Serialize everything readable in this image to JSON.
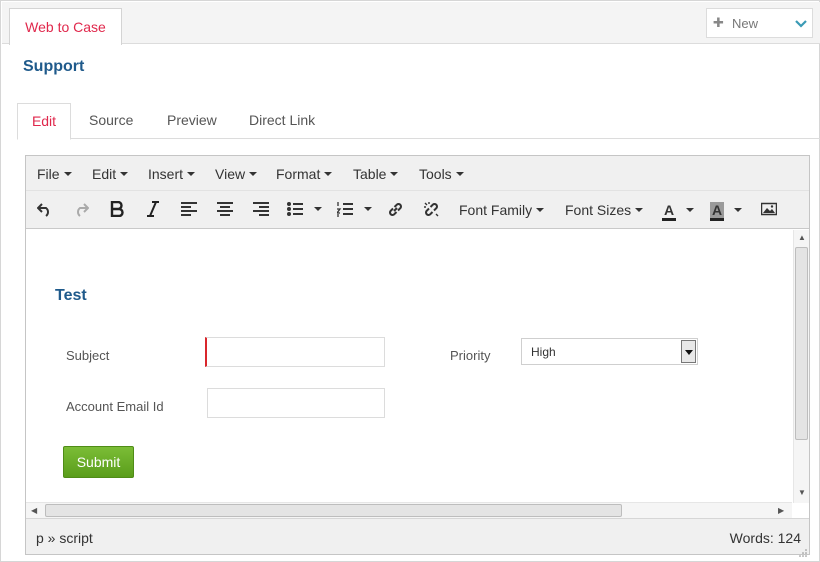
{
  "top_tab": {
    "label": "Web to Case"
  },
  "new_button": {
    "label": "New",
    "plus_icon": "plus-icon",
    "chevron_icon": "chevron-down-icon"
  },
  "page_title": "Support",
  "tabs": [
    {
      "label": "Edit",
      "active": true
    },
    {
      "label": "Source",
      "active": false
    },
    {
      "label": "Preview",
      "active": false
    },
    {
      "label": "Direct Link",
      "active": false
    }
  ],
  "editor": {
    "menus": [
      "File",
      "Edit",
      "Insert",
      "View",
      "Format",
      "Table",
      "Tools"
    ],
    "toolbar": {
      "font_family": "Font Family",
      "font_sizes": "Font Sizes",
      "text_color_glyph": "A",
      "bg_color_glyph": "A"
    },
    "content": {
      "title": "Test",
      "subject_label": "Subject",
      "subject_value": "",
      "priority_label": "Priority",
      "priority_value": "High",
      "email_label": "Account Email Id",
      "email_value": "",
      "submit_label": "Submit"
    },
    "status": {
      "path": "p » script",
      "words": "Words: 124"
    }
  },
  "colors": {
    "accent_red": "#e0284c",
    "title_blue": "#1f5a8b",
    "submit_green": "#6aad28"
  }
}
